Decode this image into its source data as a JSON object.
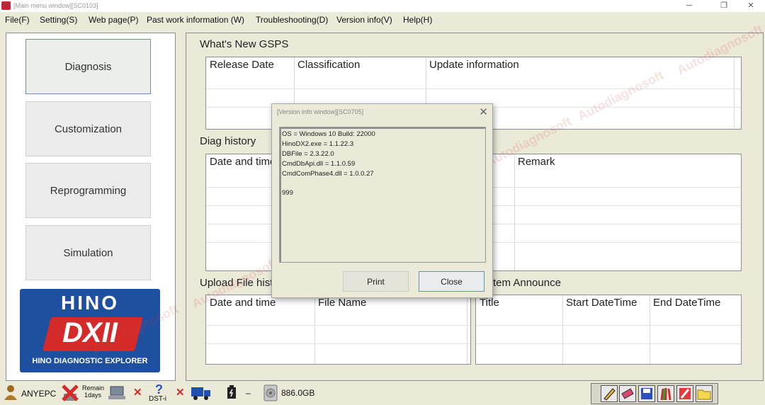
{
  "window": {
    "title": "[Main menu window][SC0103]",
    "controls": {
      "minimize": "─",
      "maximize": "❐",
      "close": "✕"
    }
  },
  "menu": [
    "File(F)",
    "Setting(S)",
    "Web page(P)",
    "Past work information (W)",
    "Troubleshooting(D)",
    "Version info(V)",
    "Help(H)"
  ],
  "nav": {
    "buttons": [
      "Diagnosis",
      "Customization",
      "Reprogramming",
      "Simulation"
    ],
    "logo": {
      "brand": "HINO",
      "product": "DXII",
      "tagline": "HINO DIAGNOSTIC EXPLORER"
    }
  },
  "sections": {
    "whats_new": {
      "title": "What's New GSPS",
      "columns": [
        "Release Date",
        "Classification",
        "Update information"
      ]
    },
    "diag_history": {
      "title": "Diag history",
      "columns": [
        "Date and time",
        "Remark"
      ]
    },
    "upload_history": {
      "title": "Upload File history",
      "columns": [
        "Date and time",
        "File Name"
      ]
    },
    "system_announce": {
      "title": "System Announce",
      "columns": [
        "Title",
        "Start DateTime",
        "End DateTime"
      ]
    }
  },
  "dialog": {
    "title": "[Version info window][SC0705]",
    "close": "✕",
    "lines": [
      "OS = Windows 10 Build: 22000",
      "HinoDX2.exe = 1.1.22.3",
      "DBFile = 2.3.22.0",
      "CmdDbApi.dll = 1.1.0.59",
      "CmdComPhase4.dll = 1.0.0.27",
      "",
      "999"
    ],
    "buttons": {
      "print": "Print",
      "close": "Close"
    }
  },
  "status": {
    "user": "ANYEPC",
    "remain": "Remain",
    "days": "1days",
    "device": "DST-i",
    "dash": "–",
    "disk": "886.0GB"
  },
  "watermark": "Autodiagnosoft",
  "colors": {
    "accent_red": "#d42a2a",
    "logo_blue": "#1f4f9f",
    "focus_border": "#6a8fb0"
  }
}
